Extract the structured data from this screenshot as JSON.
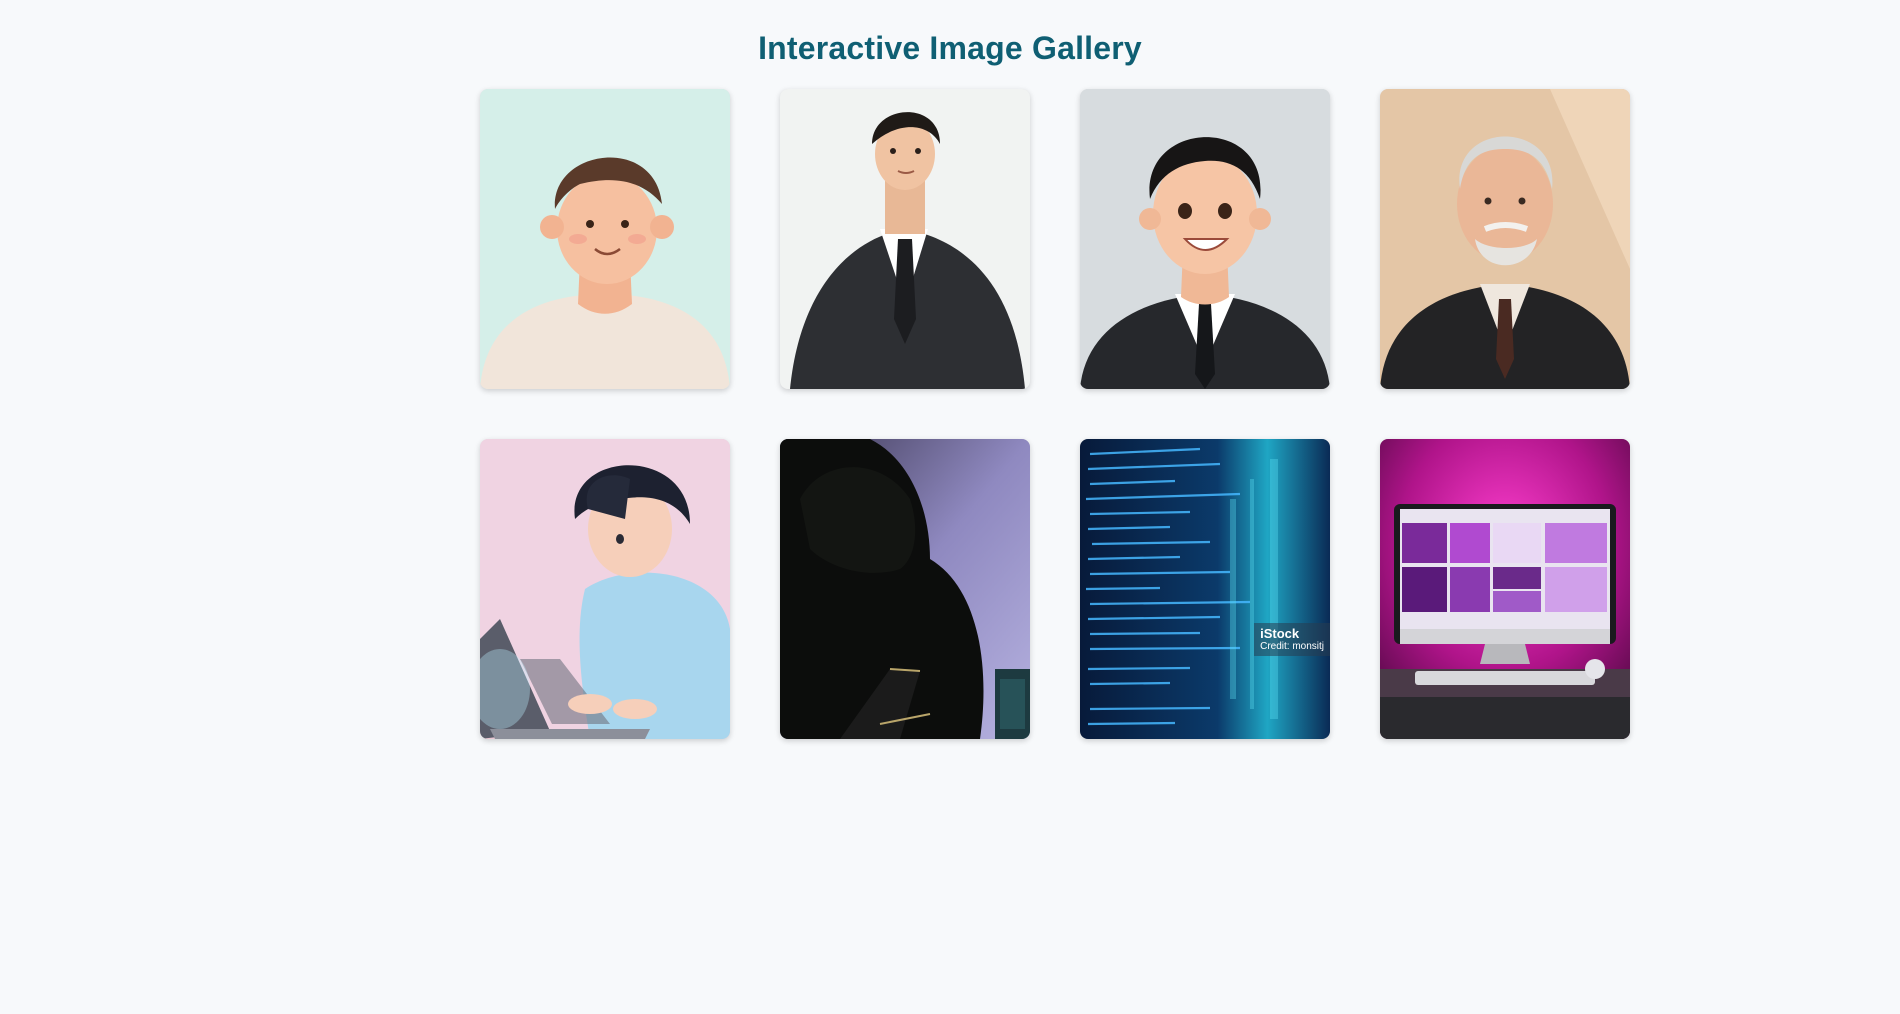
{
  "page": {
    "title": "Interactive Image Gallery",
    "background": "#f7f9fb",
    "title_color": "#0f5f73"
  },
  "gallery": {
    "items": [
      {
        "subject": "young man in cream sweater, mint background",
        "icon": "portrait-casual-icon"
      },
      {
        "subject": "man in black suit looking up",
        "icon": "portrait-suit-icon"
      },
      {
        "subject": "smiling young man in suit",
        "icon": "portrait-smile-icon"
      },
      {
        "subject": "elderly man with white beard in suit",
        "icon": "portrait-elder-icon"
      },
      {
        "subject": "boy typing on laptop",
        "icon": "laptop-user-icon"
      },
      {
        "subject": "hooded hacker with laptop",
        "icon": "hacker-icon"
      },
      {
        "subject": "code on blue screen",
        "icon": "code-screen-icon",
        "watermark": {
          "brand": "iStock",
          "credit": "Credit: monsitj"
        }
      },
      {
        "subject": "desktop monitor with purple lighting",
        "icon": "desktop-monitor-icon"
      }
    ]
  }
}
